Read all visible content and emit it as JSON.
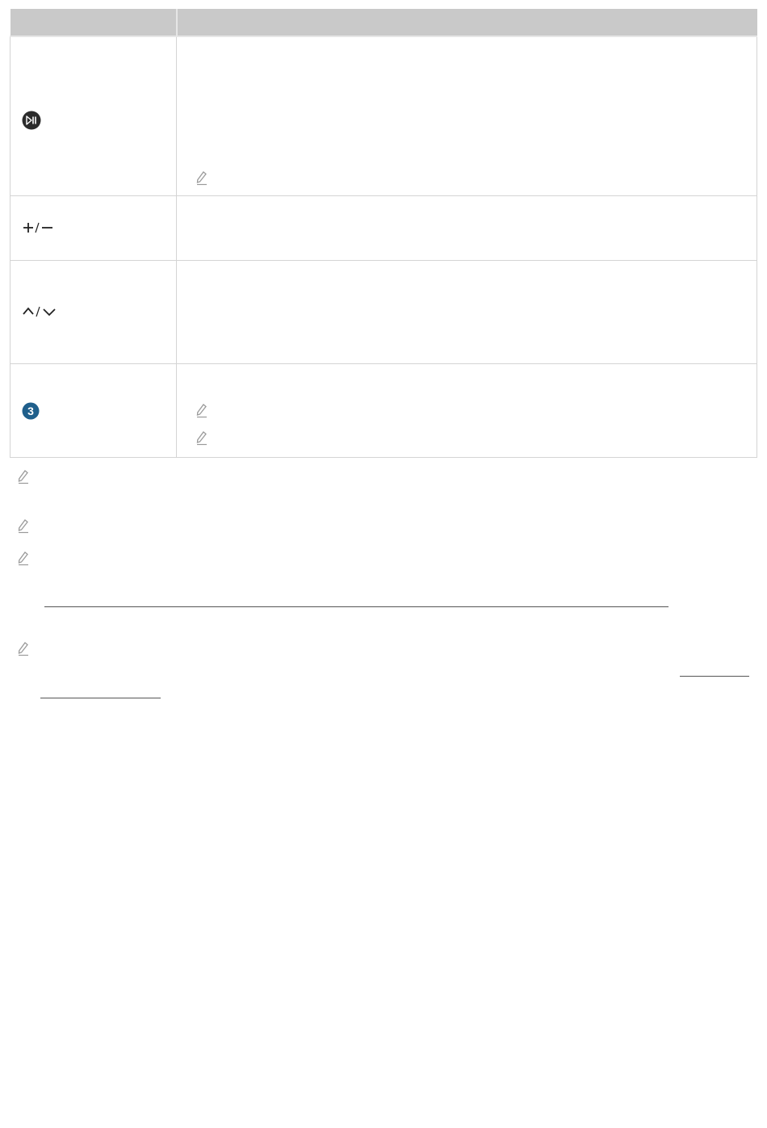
{
  "table": {
    "header": {
      "button_column": "",
      "description_column": ""
    },
    "rows": [
      {
        "button": "",
        "button_icon": "play-pause-icon",
        "description_notes": [
          "pencil-note-icon"
        ]
      },
      {
        "button": "+/−",
        "button_icon": "volume-plus-minus-icon",
        "description_notes": []
      },
      {
        "button": "",
        "button_icon": "channel-up-down-icon",
        "description_notes": []
      },
      {
        "button": "3",
        "button_icon": "numbered-badge-3-icon",
        "description_notes": [
          "pencil-note-icon",
          "pencil-note-icon"
        ]
      }
    ]
  },
  "footnotes": {
    "icon": "pencil-note-icon",
    "count": 4
  },
  "colors": {
    "header_bg": "#c9c9c9",
    "border": "#d4d4d4",
    "badge_blue": "#1f5f8b",
    "icon_dark": "#2b2b2b",
    "pencil_gray": "#9a9a9a"
  }
}
